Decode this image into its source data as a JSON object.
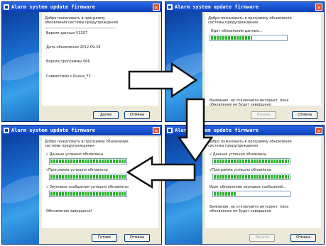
{
  "common": {
    "title": "Alarm system update firmware",
    "welcome": "Добро пожаловать в программу обновления системы предупреждения"
  },
  "w1": {
    "rows": [
      "Версия данных V1207",
      "Дата обновления 2012-09-29",
      "Версия программы V66",
      "Совместимо с Russia_F2"
    ],
    "btn_next": "Далее",
    "btn_cancel": "Отмена"
  },
  "w2": {
    "status": "Идет обновление данных...",
    "progress": 0.55,
    "warning": "Внимание: не отключайте интернет, пока обновление не будет завершено",
    "btn_start": "Начало",
    "btn_cancel": "Отмена"
  },
  "w3": {
    "line1": "√ Данные успешно обновлены",
    "line2": "√Программа успешно обновлена",
    "line3": "√ Звуковые сообщения успешно обновлены",
    "done": "Обновление завершено!",
    "btn_done": "Готово",
    "btn_cancel": "Отмена"
  },
  "w4": {
    "line1": "√ Данные успешно обновлены",
    "line2": "√Программа успешно обновлена",
    "status": "Идет обновление звуковых сообщений...",
    "progress": 0.3,
    "warning": "Внимание: не отключайте интернет, пока обновление не будет завершено",
    "btn_start": "Начало",
    "btn_cancel": "Отмена"
  },
  "colors": {
    "progress": "#2fb42f",
    "titlebar": "#0a3fb8",
    "close": "#e1522f"
  }
}
